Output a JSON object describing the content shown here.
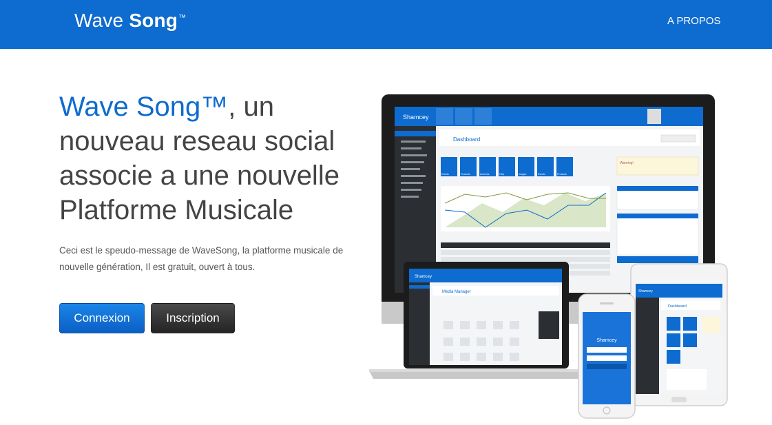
{
  "header": {
    "brand_light": "Wave ",
    "brand_bold": "Song",
    "brand_tm": "™",
    "nav_about": "A PROPOS"
  },
  "hero": {
    "headline_accent": "Wave Song™",
    "headline_rest": ", un nouveau reseau social associe a une nouvelle Platforme Musicale",
    "lead": "Ceci est le speudo-message de WaveSong, la platforme musicale de nouvelle génération, Il est gratuit, ouvert à tous.",
    "login_label": "Connexion",
    "signup_label": "Inscription"
  },
  "mockup": {
    "desktop_brand": "Shamcey",
    "desktop_page_title": "Dashboard",
    "desktop_tiles": [
      "Events",
      "Products",
      "Archives",
      "Help",
      "Images",
      "Events",
      "Products"
    ],
    "desktop_warning": "Warning!",
    "laptop_brand": "Shamcey",
    "laptop_page_title": "Media Manager",
    "phone_brand": "Shamcey",
    "tablet_brand": "Shamcey",
    "tablet_page_title": "Dashboard",
    "tablet_tiles": [
      "Events",
      "Products",
      "Archives",
      "Help",
      "Images"
    ],
    "colors": {
      "brand_blue": "#0e6bcf",
      "dark_button": "#2e2e2e",
      "sidebar_dark": "#2b2f33",
      "device_bezel": "#1c1c1c"
    }
  }
}
